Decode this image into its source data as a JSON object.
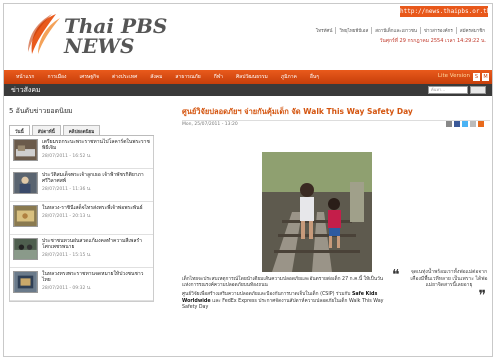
{
  "header": {
    "logo_line1": "Thai PBS",
    "logo_line2": "NEWS",
    "url": "http://news.thaipbs.or.th",
    "top_links": [
      "โทรทัศน์",
      "วิทยุไทยพีบีเอส",
      "สถานีเด็กและเยาวชน",
      "ข่าวสารองค์กร",
      "สมัครสมาชิก"
    ],
    "date_line": "วันศุกร์ที่ 29 กรกฎาคม 2554 เวลา 14:29:22 น."
  },
  "nav": {
    "items": [
      "หน้าแรก",
      "การเมือง",
      "เศรษฐกิจ",
      "ต่างประเทศ",
      "สังคม",
      "สาธารณภัย",
      "กีฬา",
      "ศิลปวัฒนธรรม",
      "ภูมิภาค",
      "อื่นๆ"
    ],
    "lite_label": "Lite Version",
    "size_small": "S",
    "size_medium": "M"
  },
  "subbar": {
    "title": "ข่าวสังคม",
    "search_placeholder": "ค้นหา..."
  },
  "left": {
    "title": "5 อันดับข่าวยอดนิยม",
    "tabs": [
      "วันนี้",
      "สัปดาห์นี้",
      "คลิปยอดนิยม"
    ],
    "items": [
      {
        "title": "เตรียมรถกระบะพระราชทานไปโลคาร์ตในพระราชพิธีเจิม",
        "date": "28/07/2011 - 16:52 น."
      },
      {
        "title": "ประวัติสมเด็จพระเจ้าลูกเธอ เจ้าฟ้าพัชรกิติยาภา ศรีวิลาศสพ์",
        "date": "28/07/2011 - 11:36 น."
      },
      {
        "title": "ในหลวง-ราชินีเสด็จไทรส่งพระพี่เจ้าพ่อพระพันธ์",
        "date": "28/07/2011 - 20:13 น."
      },
      {
        "title": "ประชาชนทวนฝนสวดแก้มงคลทำความสีเพลรำโศกเพชรพนาย",
        "date": "28/07/2011 - 15:15 น."
      },
      {
        "title": "ในหลวงทรงพระราชทานจดหมายให้ปวงชนชาวไทย",
        "date": "28/07/2011 - 09:32 น."
      }
    ]
  },
  "article": {
    "title": "ศูนย์วิจัยปลอดภัยฯ จ่ายกันคุ้มเด็ก จัด Walk This Way Safety Day",
    "date": "Mon, 25/07/2011 - 13:20",
    "caption_p1": "เด็กไทยจะประสบเหตุการณ์โดยนำเตียมเส้นความปลอดภัยและอันตรายต่อเด็ก 27 ก.ค.นี้ ให้เป็นวันแห่งการรณรงค์ความปลอดภัยบนท้องถนน",
    "caption_p2": "ศูนย์วิจัยเพื่อสร้างเสริมความปลอดภัยและป้องกันการบาดเจ็บในเด็ก (CSIP) ร่วมกับ",
    "caption_bold": "Safe Kids Worldwide",
    "caption_p3": "และ FedEx Express ประกาศจัดงานสัปดาห์ความปลอดภัยในเด็ก Walk This Way Safety Day",
    "quote": "จุดเนทุ่งน้ำพร้อมเราทั้งพ่อแม่ต่อจากเคืองมีพื้นเวทีหลาย เป็นเพราะ ได้พ่อแม่ยาจิดสารนี้เลยอายุ"
  },
  "colors": {
    "brand_orange": "#e95a1c",
    "nav_dark": "#c63e0a",
    "title_orange": "#d4540e"
  }
}
